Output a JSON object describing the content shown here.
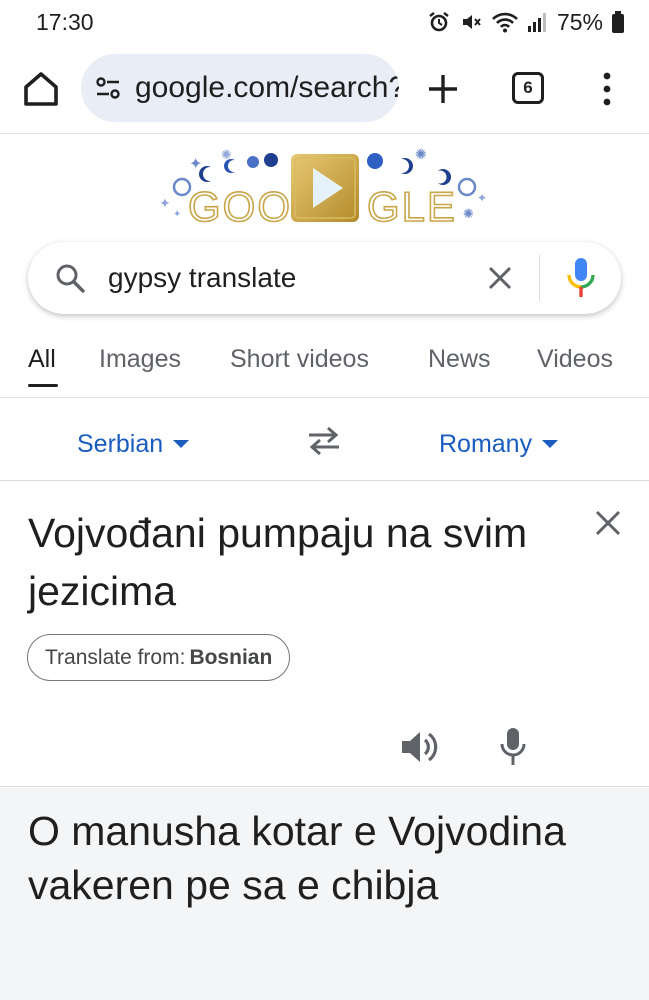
{
  "status_bar": {
    "time": "17:30",
    "battery": "75%",
    "icons": [
      "alarm-icon",
      "mute-icon",
      "wifi-icon",
      "signal-icon",
      "battery-icon"
    ]
  },
  "browser": {
    "url": "google.com/search?q=gypsy+translate",
    "tab_count": "6",
    "icons": [
      "home-icon",
      "site-settings-icon",
      "new-tab-icon",
      "menu-icon"
    ]
  },
  "doodle": {
    "text": "GOOGLE",
    "icons": [
      "play-icon"
    ]
  },
  "search": {
    "query": "gypsy translate",
    "icons": [
      "search-icon",
      "clear-icon",
      "mic-icon"
    ]
  },
  "tabs": [
    {
      "label": "All",
      "active": true
    },
    {
      "label": "Images",
      "active": false
    },
    {
      "label": "Short videos",
      "active": false
    },
    {
      "label": "News",
      "active": false
    },
    {
      "label": "Videos",
      "active": false
    }
  ],
  "translator": {
    "source_lang": "Serbian",
    "target_lang": "Romany",
    "source_text": "Vojvođani pumpaju na svim jezicima",
    "detected_prefix": "Translate from:",
    "detected_lang": "Bosnian",
    "result_text": "O manusha kotar e Vojvodina vakeren pe sa e chibja",
    "icons": [
      "swap-icon",
      "close-icon",
      "speaker-icon",
      "mic-icon"
    ]
  },
  "colors": {
    "accent_blue": "#1a5dbf",
    "url_bar_bg": "#e9eef6",
    "result_bg": "#f4f5f6",
    "google_blue": "#4285f4",
    "google_red": "#ea4335",
    "google_yellow": "#fbbc04",
    "google_green": "#34a853"
  }
}
